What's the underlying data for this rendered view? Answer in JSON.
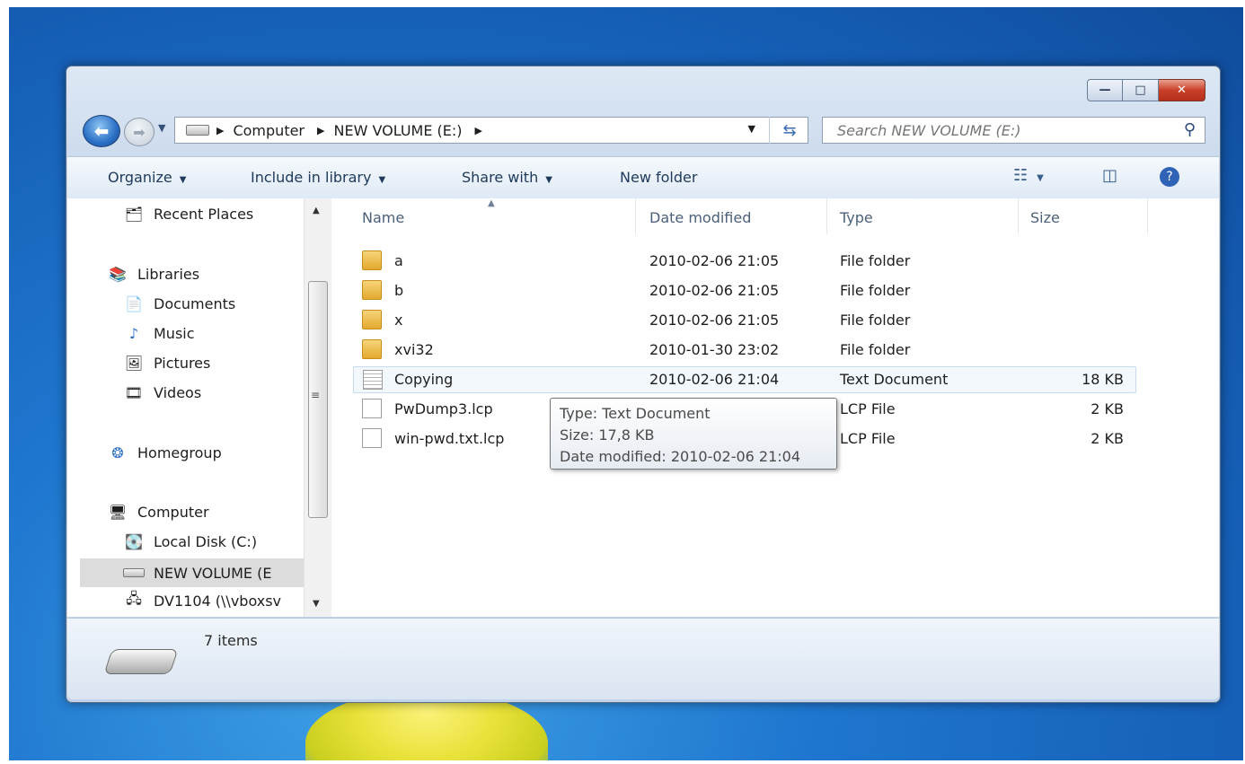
{
  "window": {
    "caption_buttons": {
      "minimize": "—",
      "maximize": "□",
      "close": "✕"
    }
  },
  "nav": {
    "breadcrumb": [
      "Computer",
      "NEW VOLUME (E:)"
    ],
    "search_placeholder": "Search NEW VOLUME (E:)"
  },
  "toolbar": {
    "organize": "Organize",
    "include_in_library": "Include in library",
    "share_with": "Share with",
    "new_folder": "New folder"
  },
  "sidebar": {
    "items": [
      {
        "label": "Recent Places",
        "icon": "recent-places-icon"
      },
      {
        "label": "Libraries",
        "icon": "libraries-icon"
      },
      {
        "label": "Documents",
        "icon": "documents-icon"
      },
      {
        "label": "Music",
        "icon": "music-icon"
      },
      {
        "label": "Pictures",
        "icon": "pictures-icon"
      },
      {
        "label": "Videos",
        "icon": "videos-icon"
      },
      {
        "label": "Homegroup",
        "icon": "homegroup-icon"
      },
      {
        "label": "Computer",
        "icon": "computer-icon"
      },
      {
        "label": "Local Disk (C:)",
        "icon": "local-disk-icon"
      },
      {
        "label": "NEW VOLUME (E",
        "icon": "drive-icon",
        "selected": true
      },
      {
        "label": "DV1104 (\\\\vboxsv",
        "icon": "network-drive-icon"
      }
    ]
  },
  "columns": [
    "Name",
    "Date modified",
    "Type",
    "Size"
  ],
  "files": [
    {
      "name": "a",
      "date": "2010-02-06 21:05",
      "type": "File folder",
      "size": "",
      "icon": "folder-icon"
    },
    {
      "name": "b",
      "date": "2010-02-06 21:05",
      "type": "File folder",
      "size": "",
      "icon": "folder-icon"
    },
    {
      "name": "x",
      "date": "2010-02-06 21:05",
      "type": "File folder",
      "size": "",
      "icon": "folder-icon"
    },
    {
      "name": "xvi32",
      "date": "2010-01-30 23:02",
      "type": "File folder",
      "size": "",
      "icon": "folder-icon"
    },
    {
      "name": "Copying",
      "date": "2010-02-06 21:04",
      "type": "Text Document",
      "size": "18 KB",
      "icon": "text-document-icon",
      "hovered": true
    },
    {
      "name": "PwDump3.lcp",
      "date": "",
      "type": "LCP File",
      "size": "2 KB",
      "icon": "file-icon"
    },
    {
      "name": "win-pwd.txt.lcp",
      "date": "",
      "type": "LCP File",
      "size": "2 KB",
      "icon": "file-icon"
    }
  ],
  "tooltip": {
    "type": "Type: Text Document",
    "size": "Size: 17,8 KB",
    "date": "Date modified: 2010-02-06 21:04"
  },
  "details": {
    "item_count": "7 items"
  },
  "colors": {
    "desktop": "#1f77cf",
    "close_button": "#c9402a",
    "folder": "#e3a92e"
  }
}
